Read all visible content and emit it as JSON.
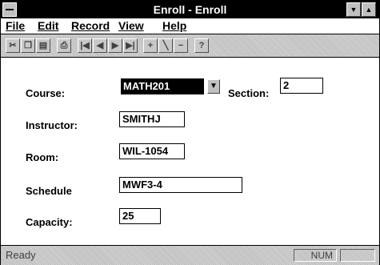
{
  "window": {
    "title": "Enroll - Enroll"
  },
  "menubar": {
    "items": [
      {
        "label": "File"
      },
      {
        "label": "Edit"
      },
      {
        "label": "Record"
      },
      {
        "label": "View"
      },
      {
        "label": "Help"
      }
    ]
  },
  "toolbar": {
    "buttons": [
      {
        "icon": "cut-icon"
      },
      {
        "icon": "copy-icon"
      },
      {
        "icon": "paste-icon"
      },
      {
        "icon": "print-icon"
      },
      {
        "icon": "first-record-icon"
      },
      {
        "icon": "previous-record-icon"
      },
      {
        "icon": "next-record-icon"
      },
      {
        "icon": "last-record-icon"
      },
      {
        "icon": "add-record-icon"
      },
      {
        "icon": "edit-record-icon"
      },
      {
        "icon": "delete-record-icon"
      },
      {
        "icon": "help-icon"
      }
    ]
  },
  "form": {
    "course_label": "Course:",
    "course_value": "MATH201",
    "section_label": "Section:",
    "section_value": "2",
    "instructor_label": "Instructor:",
    "instructor_value": "SMITHJ",
    "room_label": "Room:",
    "room_value": "WIL-1054",
    "schedule_label": "Schedule",
    "schedule_value": "MWF3-4",
    "capacity_label": "Capacity:",
    "capacity_value": "25"
  },
  "status": {
    "text": "Ready",
    "num": "NUM"
  }
}
